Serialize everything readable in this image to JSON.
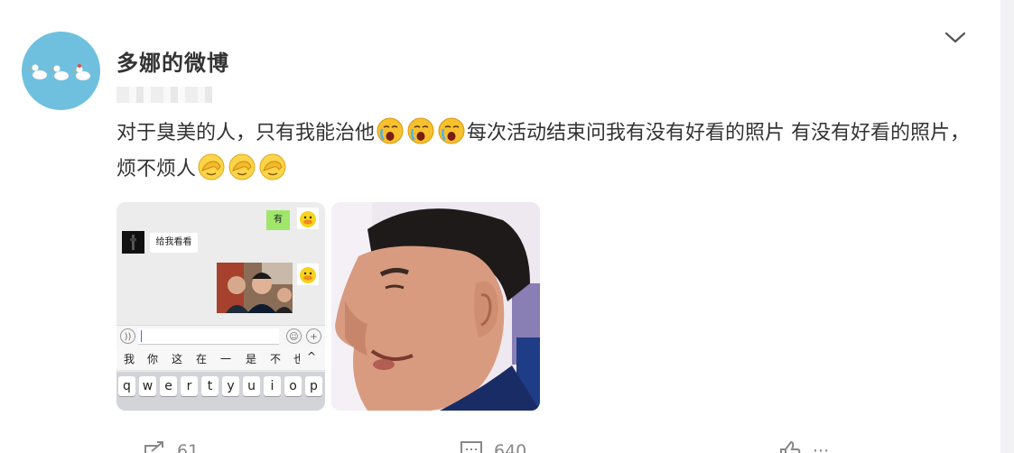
{
  "post": {
    "author": "多娜的微博",
    "text_part1": "对于臭美的人，只有我能治他",
    "text_part2": "每次活动结束问我有没有好看的照片 有没有好看的照片，烦不烦人",
    "emoji_group1": [
      "crying-face-emoji",
      "crying-face-emoji",
      "crying-face-emoji"
    ],
    "emoji_group2": [
      "facepalm-emoji",
      "facepalm-emoji",
      "facepalm-emoji"
    ]
  },
  "image1": {
    "chat_reply_me": "有",
    "chat_request_other": "给我看看",
    "candidates": [
      "我",
      "你",
      "这",
      "在",
      "一",
      "是",
      "不",
      "也"
    ],
    "keys": [
      "q",
      "w",
      "e",
      "r",
      "t",
      "y",
      "u",
      "i",
      "o",
      "p"
    ]
  },
  "actions": {
    "repost_count": "61",
    "comment_count": "640",
    "like_count": "···"
  },
  "colors": {
    "avatar_bg": "#6fc0de",
    "chat_green": "#9fe66b",
    "text": "#333333"
  }
}
